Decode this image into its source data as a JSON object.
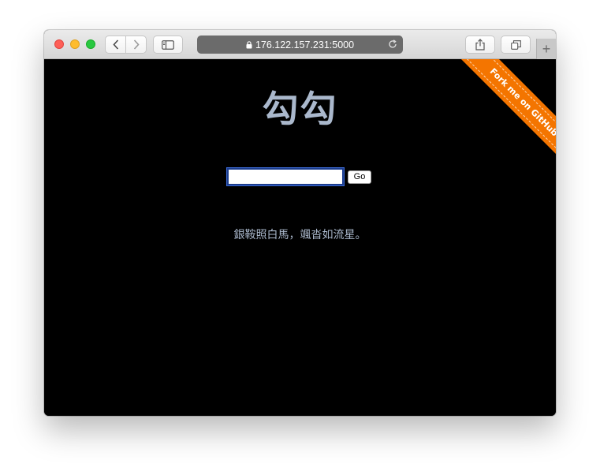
{
  "browser": {
    "url": "176.122.157.231:5000",
    "icons": {
      "back": "chevron-left-icon",
      "forward": "chevron-right-icon",
      "sidebar": "sidebar-icon",
      "lock": "lock-icon",
      "reload": "reload-icon",
      "share": "share-icon",
      "tabs": "tabs-icon",
      "new_tab": "plus-icon"
    }
  },
  "page": {
    "title": "勾勾",
    "search": {
      "value": "",
      "placeholder": "",
      "submit_label": "Go"
    },
    "quote": "銀鞍照白馬，颯沓如流星。",
    "ribbon": {
      "label": "Fork me on GitHub",
      "color": "#f47500"
    },
    "colors": {
      "background": "#000000",
      "text": "#aab8cc"
    }
  }
}
